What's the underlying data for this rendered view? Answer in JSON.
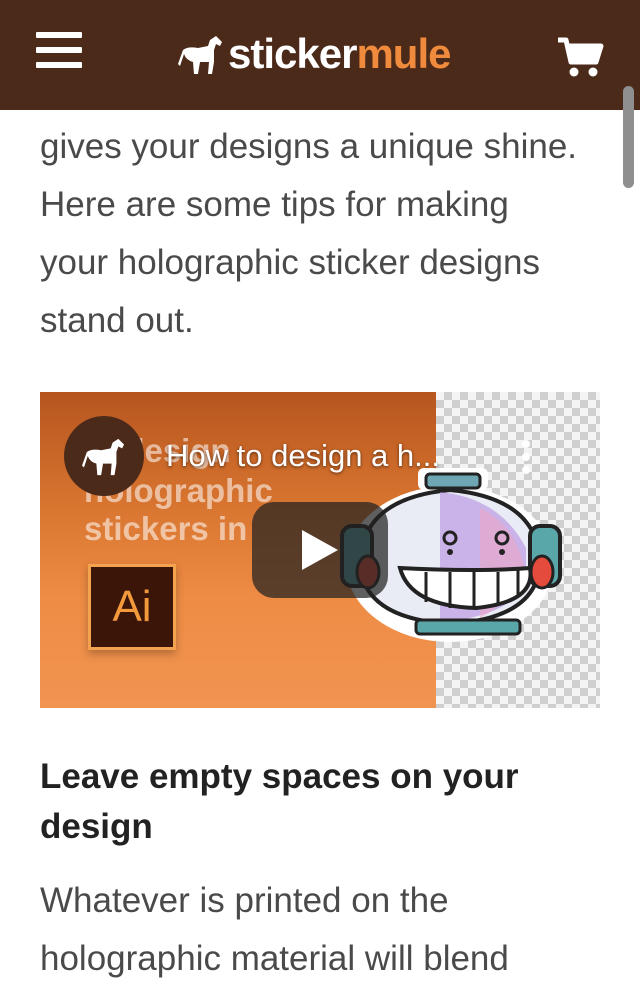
{
  "header": {
    "logo_part1": "sticker",
    "logo_part2": "mule",
    "icons": {
      "menu": "hamburger-menu-icon",
      "cart": "shopping-cart-icon",
      "logo": "horse-logo-icon"
    },
    "colors": {
      "background": "#4c2a1a",
      "logo_accent": "#f08a3c"
    }
  },
  "article": {
    "intro_lines": [
      "gives your designs a unique shine.",
      "Here are some tips for making",
      "your holographic sticker designs",
      "stand out."
    ],
    "video": {
      "title": "How to design a h...",
      "thumbnail_text_lines": [
        "to design",
        "holographic",
        "stickers in"
      ],
      "thumbnail_badge": "Ai",
      "icons": {
        "channel": "horse-avatar-icon",
        "menu": "more-vertical-icon",
        "play": "play-icon"
      }
    },
    "section_heading": "Leave empty spaces on your design",
    "body_lines": [
      "Whatever is printed on the",
      "holographic material will blend"
    ]
  }
}
